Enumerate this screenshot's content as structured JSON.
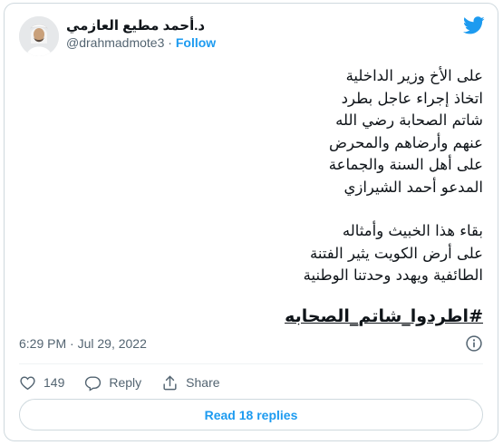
{
  "tweet": {
    "author_name": "د.أحمد مطيع العازمي",
    "handle": "@drahmadmote3",
    "separator": "·",
    "follow_label": "Follow",
    "paragraphs": [
      [
        "على الأخ وزير الداخلية",
        "اتخاذ إجراء عاجل بطرد",
        "شاتم الصحابة رضي الله",
        "عنهم وأرضاهم والمحرض",
        "على أهل السنة والجماعة",
        "المدعو أحمد الشيرازي"
      ],
      [
        "بقاء هذا الخبيث وأمثاله",
        "على أرض الكويت يثير الفتنة",
        "الطائفية ويهدد وحدتنا الوطنية"
      ]
    ],
    "hashtag": "#اطردوا_شاتم_الصحابه",
    "timestamp": "6:29 PM · Jul 29, 2022",
    "like_count": "149",
    "reply_label": "Reply",
    "share_label": "Share",
    "read_replies_label": "Read 18 replies"
  },
  "colors": {
    "accent": "#1d9bf0",
    "text": "#0f1419",
    "muted": "#536471",
    "border": "#cfd9de"
  },
  "icons": [
    "twitter-bird-icon",
    "info-icon",
    "heart-icon",
    "reply-icon",
    "share-icon"
  ]
}
